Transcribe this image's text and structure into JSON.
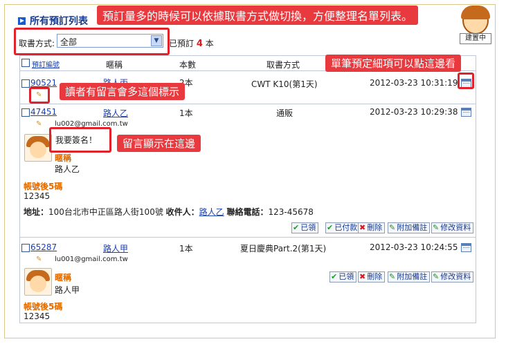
{
  "page": {
    "title": "所有預訂列表"
  },
  "filter": {
    "label": "取書方式:",
    "selected": "全部",
    "count_prefix": "已預訂",
    "count": "4",
    "count_suffix": "本"
  },
  "mascot": {
    "tag": "建置中"
  },
  "callouts": {
    "top": "預訂量多的時候可以依據取書方式做切換，方便整理名單列表。",
    "detail": "單筆預定細項可以點這邊看",
    "note_icon": "讀者有留言會多這個標示",
    "message": "留言顯示在這邊"
  },
  "table": {
    "headers": [
      "預訂編號",
      "暱稱",
      "本數",
      "取書方式"
    ],
    "rows": [
      {
        "id": "90521",
        "nick": "路人丙",
        "qty": "2本",
        "method": "CWT K10(第1天)",
        "time": "2012-03-23 10:31:19"
      },
      {
        "id": "47451",
        "nick": "路人乙",
        "qty": "1本",
        "method": "通販",
        "time": "2012-03-23 10:29:38",
        "email": "lu002@gmail.com.tw",
        "message": "我要簽名！",
        "nick_label": "暱稱",
        "nick_value": "路人乙",
        "account_label": "帳號後5碼",
        "account_value": "12345",
        "address_label": "地址：",
        "address_value": "100台北市中正區路人街100號",
        "receiver_label": "收件人：",
        "receiver_value": "路人乙",
        "phone_label": "聯絡電話：",
        "phone_value": "123-45678",
        "buttons": [
          "已領",
          "已付款",
          "刪除",
          "附加備註",
          "修改資料"
        ]
      },
      {
        "id": "65287",
        "nick": "路人甲",
        "qty": "1本",
        "method": "夏日慶典Part.2(第1天)",
        "time": "2012-03-23 10:24:55",
        "email": "lu001@gmail.com.tw",
        "nick_label": "暱稱",
        "nick_value": "路人甲",
        "account_label": "帳號後5碼",
        "account_value": "12345",
        "buttons": [
          "已領",
          "刪除",
          "附加備註",
          "修改資料"
        ]
      }
    ]
  }
}
